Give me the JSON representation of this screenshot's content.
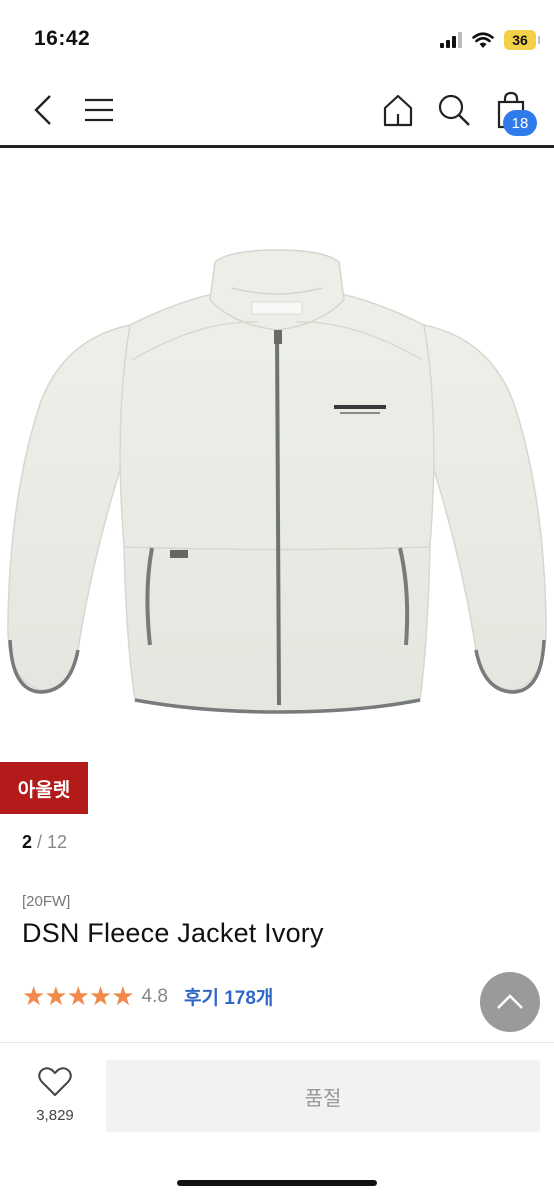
{
  "status": {
    "time": "16:42",
    "battery": "36"
  },
  "nav": {
    "cart_count": "18",
    "icons": [
      "back-icon",
      "menu-icon",
      "home-icon",
      "search-icon",
      "shopping-bag-icon"
    ]
  },
  "product": {
    "image_alt": "DSN Fleece Jacket Ivory",
    "badge": "아울렛",
    "page_current": "2",
    "page_separator": " / ",
    "page_total": "12",
    "season": "[20FW]",
    "title": "DSN Fleece Jacket Ivory",
    "stars": "★★★★★",
    "rating": 4.8,
    "reviews_label": "후기 178개"
  },
  "actions": {
    "like_count": "3,829",
    "soldout_label": "품절"
  },
  "colors": {
    "accent": "#2f7bea",
    "badge": "#b31b1b",
    "stars": "#f0894a",
    "review_link": "#2f67c9"
  }
}
